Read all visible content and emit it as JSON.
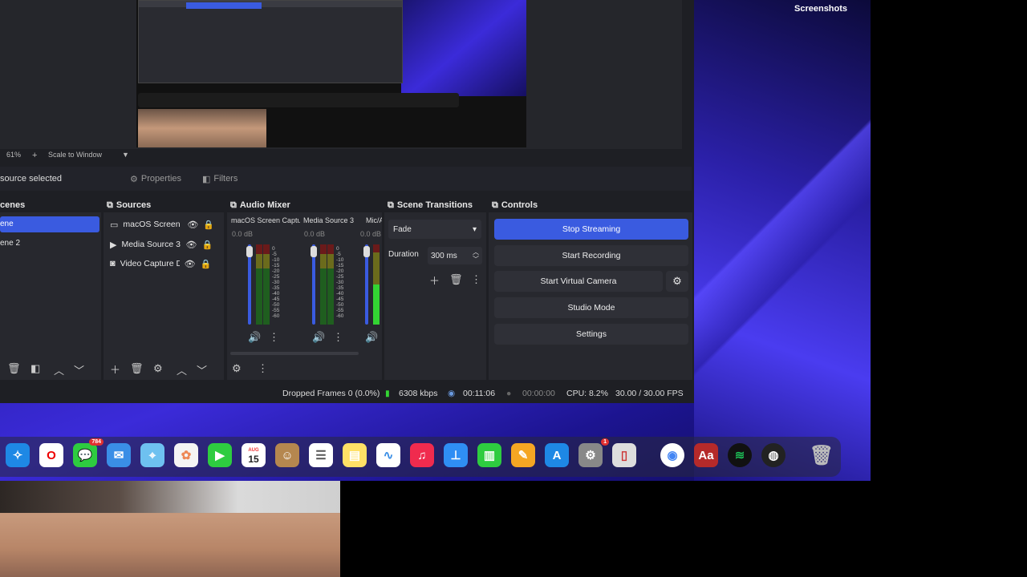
{
  "desktop": {
    "folder_label": "Screenshots"
  },
  "preview": {
    "zoom": "61%",
    "scale_mode": "Scale to Window"
  },
  "source_bar": {
    "selection_text": "source selected",
    "properties_label": "Properties",
    "filters_label": "Filters"
  },
  "scenes": {
    "title": "cenes",
    "items": [
      "ene",
      "ene 2"
    ]
  },
  "sources": {
    "title": "Sources",
    "items": [
      {
        "name": "macOS Screen C",
        "icon": "monitor-icon"
      },
      {
        "name": "Media Source 3",
        "icon": "play-icon"
      },
      {
        "name": "Video Capture D",
        "icon": "camera-icon"
      }
    ]
  },
  "audio_mixer": {
    "title": "Audio Mixer",
    "channels": [
      {
        "name": "macOS Screen Captur",
        "db": "0.0 dB"
      },
      {
        "name": "Media Source 3",
        "db": "0.0 dB"
      },
      {
        "name": "Mic/A",
        "db": "0.0 dB"
      }
    ],
    "scale": [
      "0",
      "-5",
      "-10",
      "-15",
      "-20",
      "-25",
      "-30",
      "-35",
      "-40",
      "-45",
      "-50",
      "-55",
      "-60"
    ]
  },
  "scene_transitions": {
    "title": "Scene Transitions",
    "selected": "Fade",
    "duration_label": "Duration",
    "duration_value": "300 ms"
  },
  "controls": {
    "title": "Controls",
    "stop_streaming": "Stop Streaming",
    "start_recording": "Start Recording",
    "start_virtual_camera": "Start Virtual Camera",
    "studio_mode": "Studio Mode",
    "settings": "Settings"
  },
  "status": {
    "dropped_frames": "Dropped Frames 0 (0.0%)",
    "bitrate": "6308 kbps",
    "stream_time": "00:11:06",
    "record_time": "00:00:00",
    "cpu": "CPU: 8.2%",
    "fps": "30.00 / 30.00 FPS"
  },
  "dock_apps": {
    "messages_badge": "784",
    "calendar_month": "AUG",
    "calendar_day": "15",
    "settings_badge": "1",
    "dictionary_label": "Aa"
  },
  "colors": {
    "accent": "#3a5be0",
    "panel": "#27282e",
    "window": "#1e1f24"
  }
}
